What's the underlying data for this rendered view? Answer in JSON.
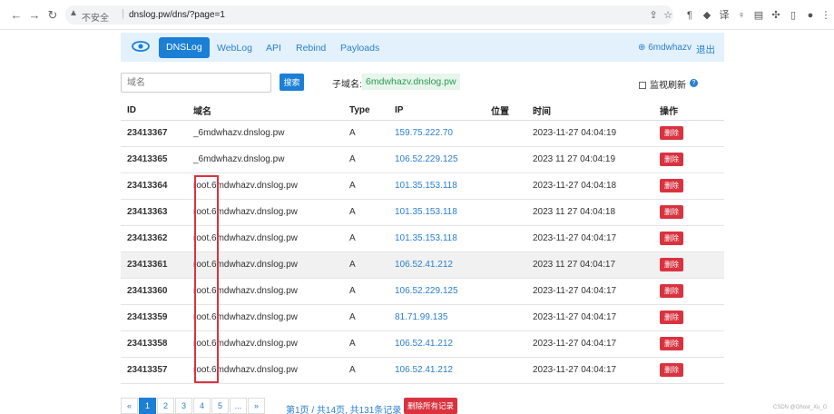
{
  "browser": {
    "insecure_label": "不安全",
    "url": "dnslog.pw/dns/?page=1"
  },
  "navbar": {
    "items": [
      "DNSLog",
      "WebLog",
      "API",
      "Rebind",
      "Payloads"
    ],
    "user": "6mdwhazv",
    "logout": "退出"
  },
  "toolbar": {
    "domain_placeholder": "域名",
    "search_label": "搜索",
    "subdomain_label": "子域名:",
    "subdomain_value": "6mdwhazv.dnslog.pw",
    "monitor_label": "监视刷新"
  },
  "table": {
    "headers": [
      "ID",
      "域名",
      "Type",
      "IP",
      "位置",
      "时间",
      "操作"
    ],
    "delete_label": "删除",
    "rows": [
      {
        "id": "23413367",
        "domain": "_6mdwhazv.dnslog.pw",
        "type": "A",
        "ip": "159.75.222.70",
        "loc": "",
        "time": "2023-11-27 04:04:19"
      },
      {
        "id": "23413365",
        "domain": "_6mdwhazv.dnslog.pw",
        "type": "A",
        "ip": "106.52.229.125",
        "loc": "",
        "time": "2023 11 27 04:04:19"
      },
      {
        "id": "23413364",
        "domain": "root.6mdwhazv.dnslog.pw",
        "type": "A",
        "ip": "101.35.153.118",
        "loc": "",
        "time": "2023-11-27 04:04:18"
      },
      {
        "id": "23413363",
        "domain": "root.6mdwhazv.dnslog.pw",
        "type": "A",
        "ip": "101.35.153.118",
        "loc": "",
        "time": "2023 11 27 04:04:18"
      },
      {
        "id": "23413362",
        "domain": "root.6mdwhazv.dnslog.pw",
        "type": "A",
        "ip": "101.35.153.118",
        "loc": "",
        "time": "2023-11-27 04:04:17"
      },
      {
        "id": "23413361",
        "domain": "root.6mdwhazv.dnslog.pw",
        "type": "A",
        "ip": "106.52.41.212",
        "loc": "",
        "time": "2023 11 27 04:04:17"
      },
      {
        "id": "23413360",
        "domain": "root.6mdwhazv.dnslog.pw",
        "type": "A",
        "ip": "106.52.229.125",
        "loc": "",
        "time": "2023-11-27 04:04:17"
      },
      {
        "id": "23413359",
        "domain": "root.6mdwhazv.dnslog.pw",
        "type": "A",
        "ip": "81.71.99.135",
        "loc": "",
        "time": "2023-11-27 04:04:17"
      },
      {
        "id": "23413358",
        "domain": "root.6mdwhazv.dnslog.pw",
        "type": "A",
        "ip": "106.52.41.212",
        "loc": "",
        "time": "2023-11-27 04:04:17"
      },
      {
        "id": "23413357",
        "domain": "root.6mdwhazv.dnslog.pw",
        "type": "A",
        "ip": "106.52.41.212",
        "loc": "",
        "time": "2023-11-27 04:04:17"
      }
    ]
  },
  "pagination": {
    "items": [
      "«",
      "1",
      "2",
      "3",
      "4",
      "5",
      "...",
      "»"
    ],
    "info": "第1页 / 共14页, 共131条记录",
    "delete_all": "删除所有记录"
  },
  "watermark": "CSDN @Ghost_Xu_G",
  "colors": {
    "primary": "#1c7fd6",
    "danger": "#d9333f",
    "navbar_bg": "#e3f1fc"
  }
}
